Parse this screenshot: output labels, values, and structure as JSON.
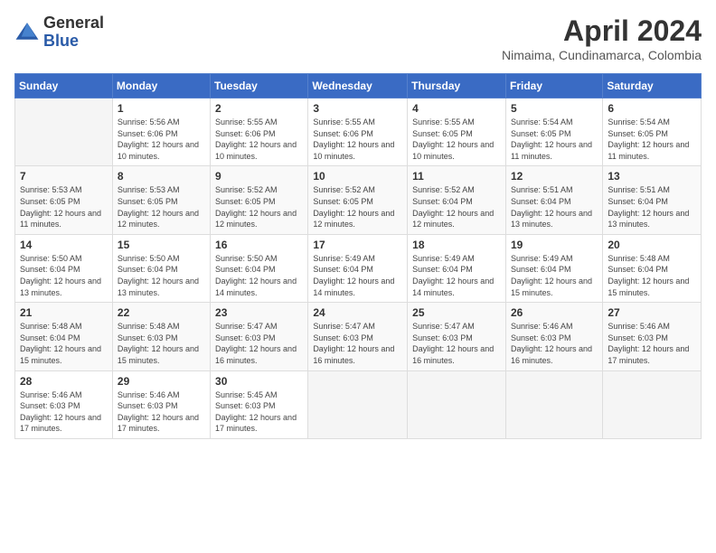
{
  "logo": {
    "general": "General",
    "blue": "Blue"
  },
  "header": {
    "month": "April 2024",
    "location": "Nimaima, Cundinamarca, Colombia"
  },
  "weekdays": [
    "Sunday",
    "Monday",
    "Tuesday",
    "Wednesday",
    "Thursday",
    "Friday",
    "Saturday"
  ],
  "weeks": [
    [
      {
        "day": "",
        "sunrise": "",
        "sunset": "",
        "daylight": ""
      },
      {
        "day": "1",
        "sunrise": "Sunrise: 5:56 AM",
        "sunset": "Sunset: 6:06 PM",
        "daylight": "Daylight: 12 hours and 10 minutes."
      },
      {
        "day": "2",
        "sunrise": "Sunrise: 5:55 AM",
        "sunset": "Sunset: 6:06 PM",
        "daylight": "Daylight: 12 hours and 10 minutes."
      },
      {
        "day": "3",
        "sunrise": "Sunrise: 5:55 AM",
        "sunset": "Sunset: 6:06 PM",
        "daylight": "Daylight: 12 hours and 10 minutes."
      },
      {
        "day": "4",
        "sunrise": "Sunrise: 5:55 AM",
        "sunset": "Sunset: 6:05 PM",
        "daylight": "Daylight: 12 hours and 10 minutes."
      },
      {
        "day": "5",
        "sunrise": "Sunrise: 5:54 AM",
        "sunset": "Sunset: 6:05 PM",
        "daylight": "Daylight: 12 hours and 11 minutes."
      },
      {
        "day": "6",
        "sunrise": "Sunrise: 5:54 AM",
        "sunset": "Sunset: 6:05 PM",
        "daylight": "Daylight: 12 hours and 11 minutes."
      }
    ],
    [
      {
        "day": "7",
        "sunrise": "Sunrise: 5:53 AM",
        "sunset": "Sunset: 6:05 PM",
        "daylight": "Daylight: 12 hours and 11 minutes."
      },
      {
        "day": "8",
        "sunrise": "Sunrise: 5:53 AM",
        "sunset": "Sunset: 6:05 PM",
        "daylight": "Daylight: 12 hours and 12 minutes."
      },
      {
        "day": "9",
        "sunrise": "Sunrise: 5:52 AM",
        "sunset": "Sunset: 6:05 PM",
        "daylight": "Daylight: 12 hours and 12 minutes."
      },
      {
        "day": "10",
        "sunrise": "Sunrise: 5:52 AM",
        "sunset": "Sunset: 6:05 PM",
        "daylight": "Daylight: 12 hours and 12 minutes."
      },
      {
        "day": "11",
        "sunrise": "Sunrise: 5:52 AM",
        "sunset": "Sunset: 6:04 PM",
        "daylight": "Daylight: 12 hours and 12 minutes."
      },
      {
        "day": "12",
        "sunrise": "Sunrise: 5:51 AM",
        "sunset": "Sunset: 6:04 PM",
        "daylight": "Daylight: 12 hours and 13 minutes."
      },
      {
        "day": "13",
        "sunrise": "Sunrise: 5:51 AM",
        "sunset": "Sunset: 6:04 PM",
        "daylight": "Daylight: 12 hours and 13 minutes."
      }
    ],
    [
      {
        "day": "14",
        "sunrise": "Sunrise: 5:50 AM",
        "sunset": "Sunset: 6:04 PM",
        "daylight": "Daylight: 12 hours and 13 minutes."
      },
      {
        "day": "15",
        "sunrise": "Sunrise: 5:50 AM",
        "sunset": "Sunset: 6:04 PM",
        "daylight": "Daylight: 12 hours and 13 minutes."
      },
      {
        "day": "16",
        "sunrise": "Sunrise: 5:50 AM",
        "sunset": "Sunset: 6:04 PM",
        "daylight": "Daylight: 12 hours and 14 minutes."
      },
      {
        "day": "17",
        "sunrise": "Sunrise: 5:49 AM",
        "sunset": "Sunset: 6:04 PM",
        "daylight": "Daylight: 12 hours and 14 minutes."
      },
      {
        "day": "18",
        "sunrise": "Sunrise: 5:49 AM",
        "sunset": "Sunset: 6:04 PM",
        "daylight": "Daylight: 12 hours and 14 minutes."
      },
      {
        "day": "19",
        "sunrise": "Sunrise: 5:49 AM",
        "sunset": "Sunset: 6:04 PM",
        "daylight": "Daylight: 12 hours and 15 minutes."
      },
      {
        "day": "20",
        "sunrise": "Sunrise: 5:48 AM",
        "sunset": "Sunset: 6:04 PM",
        "daylight": "Daylight: 12 hours and 15 minutes."
      }
    ],
    [
      {
        "day": "21",
        "sunrise": "Sunrise: 5:48 AM",
        "sunset": "Sunset: 6:04 PM",
        "daylight": "Daylight: 12 hours and 15 minutes."
      },
      {
        "day": "22",
        "sunrise": "Sunrise: 5:48 AM",
        "sunset": "Sunset: 6:03 PM",
        "daylight": "Daylight: 12 hours and 15 minutes."
      },
      {
        "day": "23",
        "sunrise": "Sunrise: 5:47 AM",
        "sunset": "Sunset: 6:03 PM",
        "daylight": "Daylight: 12 hours and 16 minutes."
      },
      {
        "day": "24",
        "sunrise": "Sunrise: 5:47 AM",
        "sunset": "Sunset: 6:03 PM",
        "daylight": "Daylight: 12 hours and 16 minutes."
      },
      {
        "day": "25",
        "sunrise": "Sunrise: 5:47 AM",
        "sunset": "Sunset: 6:03 PM",
        "daylight": "Daylight: 12 hours and 16 minutes."
      },
      {
        "day": "26",
        "sunrise": "Sunrise: 5:46 AM",
        "sunset": "Sunset: 6:03 PM",
        "daylight": "Daylight: 12 hours and 16 minutes."
      },
      {
        "day": "27",
        "sunrise": "Sunrise: 5:46 AM",
        "sunset": "Sunset: 6:03 PM",
        "daylight": "Daylight: 12 hours and 17 minutes."
      }
    ],
    [
      {
        "day": "28",
        "sunrise": "Sunrise: 5:46 AM",
        "sunset": "Sunset: 6:03 PM",
        "daylight": "Daylight: 12 hours and 17 minutes."
      },
      {
        "day": "29",
        "sunrise": "Sunrise: 5:46 AM",
        "sunset": "Sunset: 6:03 PM",
        "daylight": "Daylight: 12 hours and 17 minutes."
      },
      {
        "day": "30",
        "sunrise": "Sunrise: 5:45 AM",
        "sunset": "Sunset: 6:03 PM",
        "daylight": "Daylight: 12 hours and 17 minutes."
      },
      {
        "day": "",
        "sunrise": "",
        "sunset": "",
        "daylight": ""
      },
      {
        "day": "",
        "sunrise": "",
        "sunset": "",
        "daylight": ""
      },
      {
        "day": "",
        "sunrise": "",
        "sunset": "",
        "daylight": ""
      },
      {
        "day": "",
        "sunrise": "",
        "sunset": "",
        "daylight": ""
      }
    ]
  ]
}
